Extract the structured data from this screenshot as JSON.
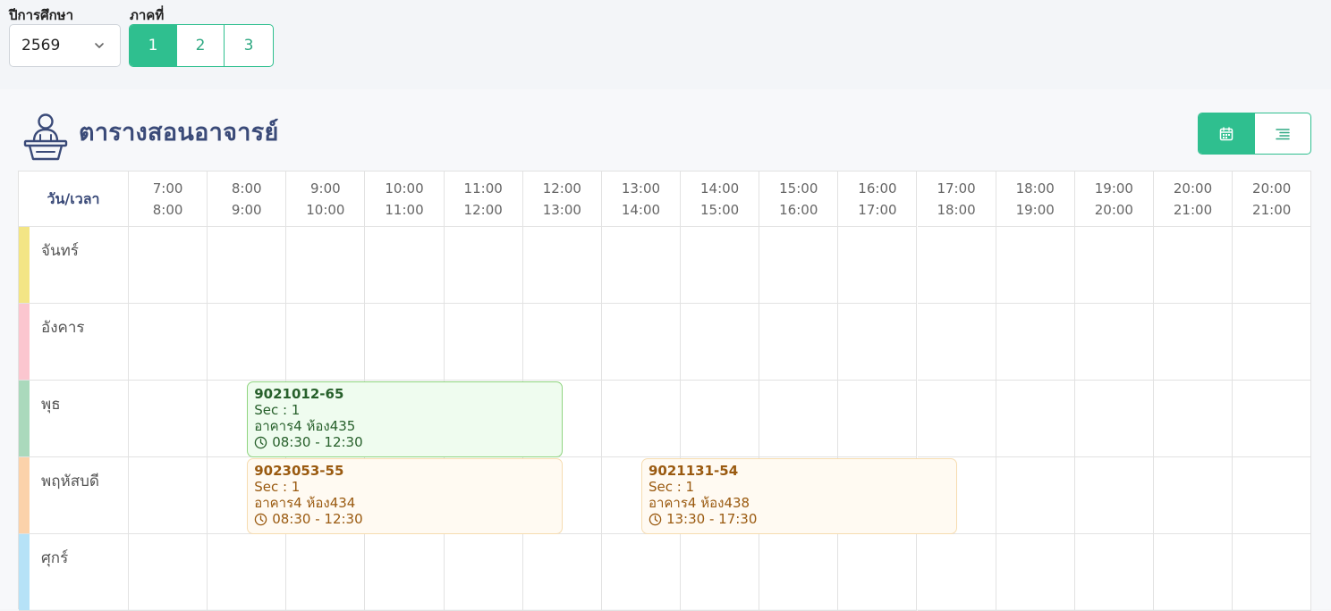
{
  "filters": {
    "year_label": "ปีการศึกษา",
    "year_value": "2569",
    "term_label": "ภาคที่",
    "terms": [
      {
        "label": "1",
        "active": true
      },
      {
        "label": "2",
        "active": false
      },
      {
        "label": "3",
        "active": false
      }
    ]
  },
  "page": {
    "title": "ตารางสอนอาจารย์",
    "view_modes": [
      "calendar-icon",
      "list-icon"
    ],
    "active_view": "calendar"
  },
  "timetable": {
    "corner_label": "วัน/เวลา",
    "time_slots": [
      {
        "start": "7:00",
        "end": "8:00"
      },
      {
        "start": "8:00",
        "end": "9:00"
      },
      {
        "start": "9:00",
        "end": "10:00"
      },
      {
        "start": "10:00",
        "end": "11:00"
      },
      {
        "start": "11:00",
        "end": "12:00"
      },
      {
        "start": "12:00",
        "end": "13:00"
      },
      {
        "start": "13:00",
        "end": "14:00"
      },
      {
        "start": "14:00",
        "end": "15:00"
      },
      {
        "start": "15:00",
        "end": "16:00"
      },
      {
        "start": "16:00",
        "end": "17:00"
      },
      {
        "start": "17:00",
        "end": "18:00"
      },
      {
        "start": "18:00",
        "end": "19:00"
      },
      {
        "start": "19:00",
        "end": "20:00"
      },
      {
        "start": "20:00",
        "end": "21:00"
      },
      {
        "start": "20:00",
        "end": "21:00"
      }
    ],
    "days": [
      {
        "label": "จันทร์",
        "color": "#f3e585"
      },
      {
        "label": "อังคาร",
        "color": "#fbc6cf"
      },
      {
        "label": "พุธ",
        "color": "#aad9bc"
      },
      {
        "label": "พฤหัสบดี",
        "color": "#fbd2aa"
      },
      {
        "label": "ศุกร์",
        "color": "#b6e2f7"
      }
    ],
    "events": [
      {
        "day": 2,
        "start_hour": 8.5,
        "end_hour": 12.5,
        "theme": "green",
        "code": "9021012-65",
        "sec": "Sec : 1",
        "room": "อาคาร4 ห้อง435",
        "time": "08:30 - 12:30"
      },
      {
        "day": 3,
        "start_hour": 8.5,
        "end_hour": 12.5,
        "theme": "orange",
        "code": "9023053-55",
        "sec": "Sec : 1",
        "room": "อาคาร4 ห้อง434",
        "time": "08:30 - 12:30"
      },
      {
        "day": 3,
        "start_hour": 13.5,
        "end_hour": 17.5,
        "theme": "orange",
        "code": "9021131-54",
        "sec": "Sec : 1",
        "room": "อาคาร4 ห้อง438",
        "time": "13:30 - 17:30"
      }
    ]
  }
}
